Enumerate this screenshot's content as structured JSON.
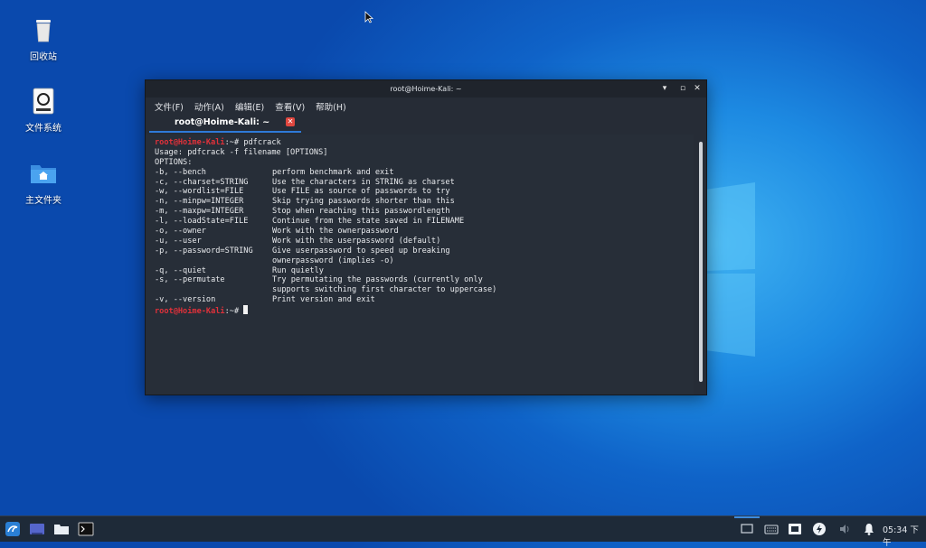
{
  "desktop": {
    "icons": [
      {
        "label": "回收站",
        "icon": "trash-icon"
      },
      {
        "label": "文件系统",
        "icon": "drive-icon"
      },
      {
        "label": "主文件夹",
        "icon": "home-folder-icon"
      }
    ]
  },
  "terminal": {
    "window_title": "root@Hoime-Kali: ~",
    "menu": [
      "文件(F)",
      "动作(A)",
      "编辑(E)",
      "查看(V)",
      "帮助(H)"
    ],
    "tab_label": "root@Hoime-Kali: ~",
    "prompt": "root@Hoime-Kali",
    "prompt_suffix": ":~# ",
    "command": "pdfcrack",
    "usage": "Usage: pdfcrack -f filename [OPTIONS]",
    "options_header": "OPTIONS:",
    "options": [
      [
        "-b, --bench",
        "perform benchmark and exit"
      ],
      [
        "-c, --charset=STRING",
        "Use the characters in STRING as charset"
      ],
      [
        "-w, --wordlist=FILE",
        "Use FILE as source of passwords to try"
      ],
      [
        "-n, --minpw=INTEGER",
        "Skip trying passwords shorter than this"
      ],
      [
        "-m, --maxpw=INTEGER",
        "Stop when reaching this passwordlength"
      ],
      [
        "-l, --loadState=FILE",
        "Continue from the state saved in FILENAME"
      ],
      [
        "-o, --owner",
        "Work with the ownerpassword"
      ],
      [
        "-u, --user",
        "Work with the userpassword (default)"
      ],
      [
        "-p, --password=STRING",
        "Give userpassword to speed up breaking"
      ],
      [
        "",
        "ownerpassword (implies -o)"
      ],
      [
        "-q, --quiet",
        "Run quietly"
      ],
      [
        "-s, --permutate",
        "Try permutating the passwords (currently only"
      ],
      [
        "",
        "supports switching first character to uppercase)"
      ],
      [
        "-v, --version",
        "Print version and exit"
      ]
    ]
  },
  "taskbar": {
    "clock": "05:34 下午"
  },
  "colors": {
    "prompt": "#e0313a",
    "tab_accent": "#2e7ad8",
    "terminal_bg": "#272e38"
  }
}
